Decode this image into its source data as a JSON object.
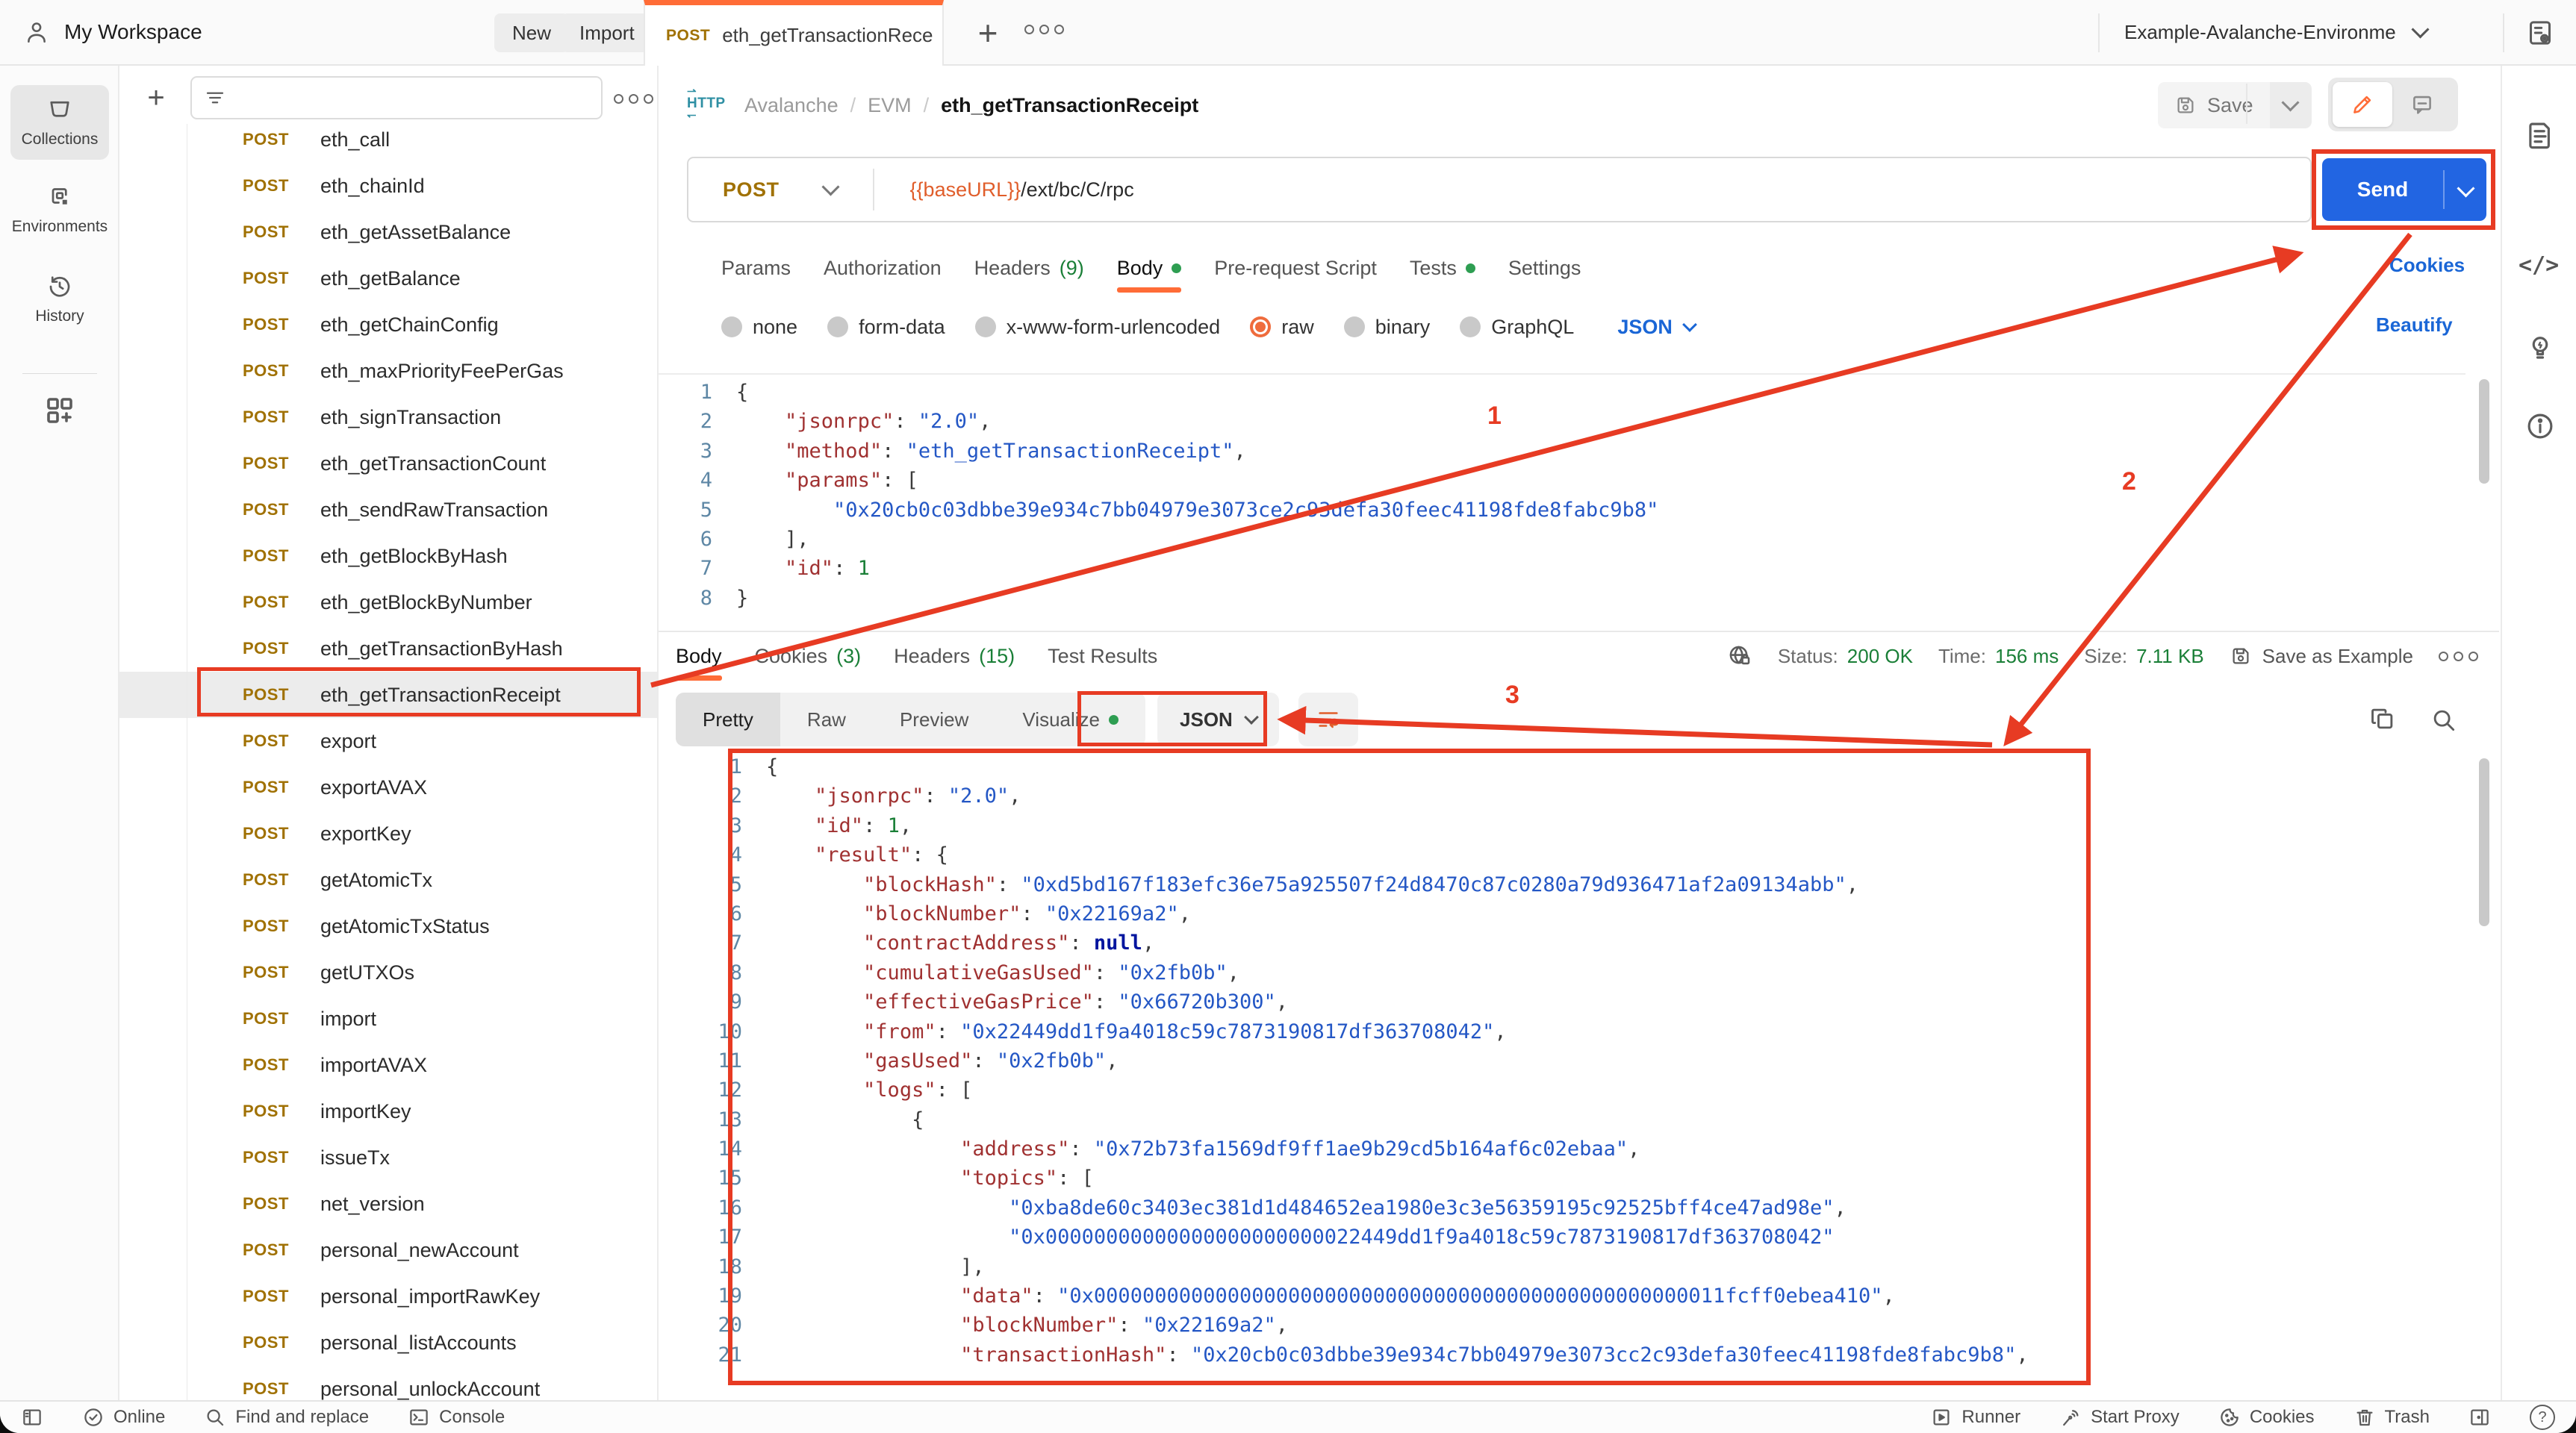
{
  "app": {
    "workspace_title": "My Workspace",
    "new_button": "New",
    "import_button": "Import",
    "environment_selector": "Example-Avalanche-Environme"
  },
  "tab": {
    "method": "POST",
    "title": "eth_getTransactionRece"
  },
  "rail": {
    "collections": "Collections",
    "environments": "Environments",
    "history": "History"
  },
  "sidebar": {
    "selected_index": 12,
    "items": [
      {
        "method": "POST",
        "name": "eth_call"
      },
      {
        "method": "POST",
        "name": "eth_chainId"
      },
      {
        "method": "POST",
        "name": "eth_getAssetBalance"
      },
      {
        "method": "POST",
        "name": "eth_getBalance"
      },
      {
        "method": "POST",
        "name": "eth_getChainConfig"
      },
      {
        "method": "POST",
        "name": "eth_maxPriorityFeePerGas"
      },
      {
        "method": "POST",
        "name": "eth_signTransaction"
      },
      {
        "method": "POST",
        "name": "eth_getTransactionCount"
      },
      {
        "method": "POST",
        "name": "eth_sendRawTransaction"
      },
      {
        "method": "POST",
        "name": "eth_getBlockByHash"
      },
      {
        "method": "POST",
        "name": "eth_getBlockByNumber"
      },
      {
        "method": "POST",
        "name": "eth_getTransactionByHash"
      },
      {
        "method": "POST",
        "name": "eth_getTransactionReceipt"
      },
      {
        "method": "POST",
        "name": "export"
      },
      {
        "method": "POST",
        "name": "exportAVAX"
      },
      {
        "method": "POST",
        "name": "exportKey"
      },
      {
        "method": "POST",
        "name": "getAtomicTx"
      },
      {
        "method": "POST",
        "name": "getAtomicTxStatus"
      },
      {
        "method": "POST",
        "name": "getUTXOs"
      },
      {
        "method": "POST",
        "name": "import"
      },
      {
        "method": "POST",
        "name": "importAVAX"
      },
      {
        "method": "POST",
        "name": "importKey"
      },
      {
        "method": "POST",
        "name": "issueTx"
      },
      {
        "method": "POST",
        "name": "net_version"
      },
      {
        "method": "POST",
        "name": "personal_newAccount"
      },
      {
        "method": "POST",
        "name": "personal_importRawKey"
      },
      {
        "method": "POST",
        "name": "personal_listAccounts"
      },
      {
        "method": "POST",
        "name": "personal_unlockAccount"
      }
    ]
  },
  "breadcrumb": {
    "protocol": "HTTP",
    "parts": [
      "Avalanche",
      "EVM"
    ],
    "separator": "/",
    "current": "eth_getTransactionReceipt"
  },
  "request_bar": {
    "save_label": "Save",
    "method": "POST",
    "url_variable": "{{baseURL}}",
    "url_path": "/ext/bc/C/rpc",
    "send_label": "Send"
  },
  "request_tabs": [
    {
      "label": "Params"
    },
    {
      "label": "Authorization"
    },
    {
      "label": "Headers",
      "count": "(9)"
    },
    {
      "label": "Body",
      "dot": true,
      "active": true
    },
    {
      "label": "Pre-request Script"
    },
    {
      "label": "Tests",
      "dot": true
    },
    {
      "label": "Settings"
    }
  ],
  "links": {
    "cookies": "Cookies",
    "beautify": "Beautify"
  },
  "body_modes": [
    {
      "label": "none"
    },
    {
      "label": "form-data"
    },
    {
      "label": "x-www-form-urlencoded"
    },
    {
      "label": "raw",
      "selected": true
    },
    {
      "label": "binary"
    },
    {
      "label": "GraphQL"
    }
  ],
  "body_format": "JSON",
  "request_editor": {
    "lines": [
      "{",
      "    \"jsonrpc\": \"2.0\",",
      "    \"method\": \"eth_getTransactionReceipt\",",
      "    \"params\": [",
      "        \"0x20cb0c03dbbe39e934c7bb04979e3073ce2c93defa30feec41198fde8fabc9b8\"",
      "    ],",
      "    \"id\": 1",
      "}"
    ]
  },
  "response": {
    "tabs": [
      {
        "label": "Body",
        "active": true
      },
      {
        "label": "Cookies",
        "count": "(3)"
      },
      {
        "label": "Headers",
        "count": "(15)"
      },
      {
        "label": "Test Results"
      }
    ],
    "status_label": "Status:",
    "status_value": "200 OK",
    "time_label": "Time:",
    "time_value": "156 ms",
    "size_label": "Size:",
    "size_value": "7.11 KB",
    "save_as_example": "Save as Example",
    "views": [
      {
        "label": "Pretty",
        "active": true
      },
      {
        "label": "Raw"
      },
      {
        "label": "Preview"
      },
      {
        "label": "Visualize",
        "dot": true
      }
    ],
    "format": "JSON"
  },
  "response_editor": {
    "lines": [
      "{",
      "    \"jsonrpc\": \"2.0\",",
      "    \"id\": 1,",
      "    \"result\": {",
      "        \"blockHash\": \"0xd5bd167f183efc36e75a925507f24d8470c87c0280a79d936471af2a09134abb\",",
      "        \"blockNumber\": \"0x22169a2\",",
      "        \"contractAddress\": null,",
      "        \"cumulativeGasUsed\": \"0x2fb0b\",",
      "        \"effectiveGasPrice\": \"0x66720b300\",",
      "        \"from\": \"0x22449dd1f9a4018c59c7873190817df363708042\",",
      "        \"gasUsed\": \"0x2fb0b\",",
      "        \"logs\": [",
      "            {",
      "                \"address\": \"0x72b73fa1569df9ff1ae9b29cd5b164af6c02ebaa\",",
      "                \"topics\": [",
      "                    \"0xba8de60c3403ec381d1d484652ea1980e3c3e56359195c92525bff4ce47ad98e\",",
      "                    \"0x00000000000000000000000022449dd1f9a4018c59c7873190817df363708042\"",
      "                ],",
      "                \"data\": \"0x0000000000000000000000000000000000000000000000000011fcff0ebea410\",",
      "                \"blockNumber\": \"0x22169a2\",",
      "                \"transactionHash\": \"0x20cb0c03dbbe39e934c7bb04979e3073cc2c93defa30feec41198fde8fabc9b8\","
    ]
  },
  "statusbar": {
    "online": "Online",
    "find": "Find and replace",
    "console": "Console",
    "runner": "Runner",
    "proxy": "Start Proxy",
    "cookies": "Cookies",
    "trash": "Trash"
  },
  "annotations": {
    "step1": "1",
    "step2": "2",
    "step3": "3"
  },
  "colors": {
    "accent_orange": "#ff6c37",
    "send_blue": "#2265e2",
    "annotation_red": "#e73b23",
    "success_green": "#1a7f37",
    "link_blue": "#1a66d6",
    "method_post": "#a07103",
    "json_key": "#a03131",
    "json_string": "#2457c5",
    "json_number": "#1a7f37"
  }
}
